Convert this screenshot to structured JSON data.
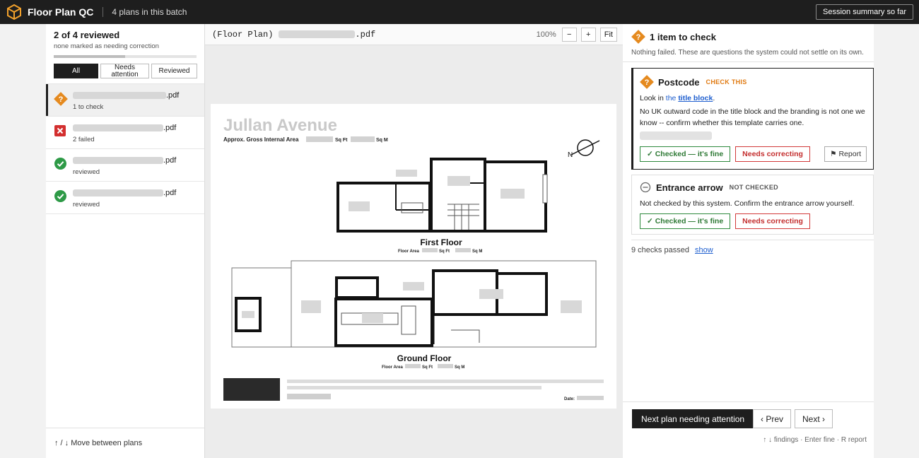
{
  "topbar": {
    "app_title": "Floor Plan QC",
    "batch_label": "4 plans in this batch",
    "session_button": "Session summary so far"
  },
  "left_panel": {
    "reviewed_count": "2 of 4 reviewed",
    "reviewed_sub": "none marked as needing correction",
    "progress_fraction": 0.5,
    "filters": [
      {
        "label": "All",
        "active": true
      },
      {
        "label": "Needs attention",
        "active": false
      },
      {
        "label": "Reviewed",
        "active": false
      }
    ],
    "files": [
      {
        "ext": ".pdf",
        "status": "1 to check",
        "icon": "question-diamond-icon",
        "selected": true
      },
      {
        "ext": ".pdf",
        "status": "2 failed",
        "icon": "fail-cross-icon",
        "selected": false
      },
      {
        "ext": ".pdf",
        "status": "reviewed",
        "icon": "check-circle-icon",
        "selected": false
      },
      {
        "ext": ".pdf",
        "status": "reviewed",
        "icon": "check-circle-icon",
        "selected": false
      }
    ],
    "footer_hint": "↑ / ↓  Move between plans"
  },
  "viewer": {
    "doc_prefix": "(Floor Plan)",
    "doc_ext": ".pdf",
    "zoom_level": "100%",
    "zoom_out": "−",
    "zoom_in": "+",
    "fit": "Fit",
    "plan": {
      "title": "Jullan Avenue",
      "gia_label": "Approx. Gross Internal Area",
      "sqft": "Sq Ft",
      "sqm": "Sq M",
      "first_floor": "First Floor",
      "ground_floor": "Ground Floor",
      "floor_area": "Floor Area",
      "date_label": "Date:"
    }
  },
  "right_panel": {
    "header_title": "1 item to check",
    "header_sub": "Nothing failed. These are questions the system could not settle on its own.",
    "postcode": {
      "title": "Postcode",
      "tag": "CHECK THIS",
      "look_in_prefix": "Look in",
      "look_in_the": "the",
      "look_in_link": "title block",
      "look_in_suffix": ".",
      "desc": "No UK outward code in the title block and the branding is not one we know -- confirm whether this template carries one.",
      "btn_fine": "✓ Checked — it's fine",
      "btn_correct": "Needs correcting",
      "btn_report": "⚑ Report"
    },
    "entrance": {
      "title": "Entrance arrow",
      "tag": "NOT CHECKED",
      "desc": "Not checked by this system. Confirm the entrance arrow yourself.",
      "btn_fine": "✓ Checked — it's fine",
      "btn_correct": "Needs correcting"
    },
    "passed_text": "9 checks passed",
    "show_link": "show",
    "next_attention": "Next plan needing attention",
    "prev": "‹ Prev",
    "next": "Next ›",
    "kbd_hint": "↑ ↓ findings · Enter fine · R report"
  },
  "colors": {
    "dark": "#1e1e1e",
    "accent_orange": "#e58a1f",
    "fail_red": "#d32f2f",
    "ok_green": "#2e9a47",
    "link_blue": "#1f5fcf"
  }
}
